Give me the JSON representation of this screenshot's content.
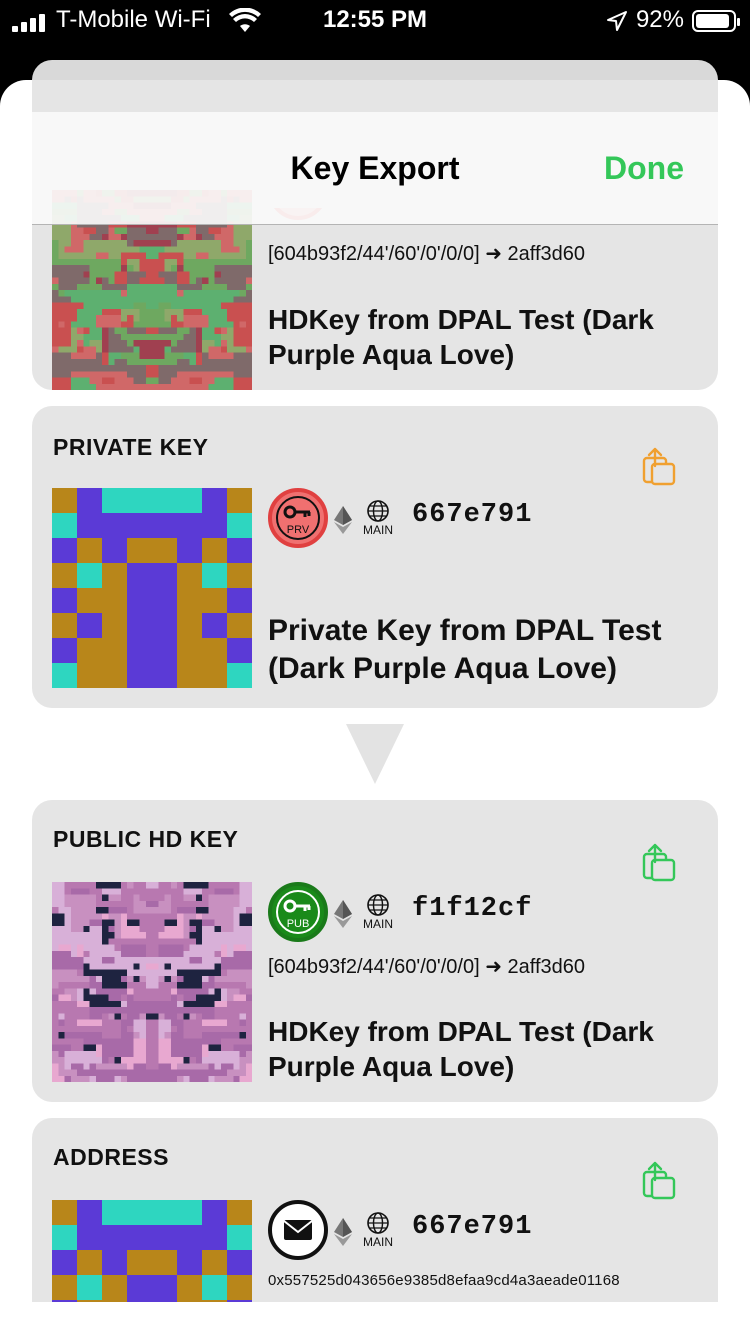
{
  "status_bar": {
    "carrier": "T-Mobile Wi-Fi",
    "time": "12:55 PM",
    "battery_percent": "92%",
    "battery_level": 0.92,
    "icons": [
      "signal-bars-icon",
      "wifi-icon",
      "location-arrow-icon",
      "battery-icon"
    ]
  },
  "navbar": {
    "title": "Key Export",
    "done_label": "Done",
    "accent_color": "#34c759"
  },
  "cards": {
    "hd_key_top": {
      "path": "[604b93f2/44'/60'/0'/0/0] ➜ 2aff3d60",
      "name": "HDKey from DPAL Test (Dark Purple Aqua Love)"
    },
    "private_key": {
      "label": "PRIVATE KEY",
      "badge": "PRV",
      "network": "MAIN",
      "key_id": "667e791",
      "name": "Private Key from DPAL Test (Dark Purple Aqua Love)",
      "share_color": "#f0a030"
    },
    "public_hd_key": {
      "label": "PUBLIC HD KEY",
      "badge": "PUB",
      "network": "MAIN",
      "key_id": "f1f12cf",
      "path": "[604b93f2/44'/60'/0'/0/0] ➜ 2aff3d60",
      "name": "HDKey from DPAL Test (Dark Purple Aqua Love)",
      "share_color": "#34c759"
    },
    "address": {
      "label": "ADDRESS",
      "network": "MAIN",
      "key_id": "667e791",
      "address": "0x557525d043656e9385d8efaa9cd4a3aeade01168",
      "share_color": "#34c759"
    }
  },
  "icons": [
    "ethereum-icon",
    "globe-icon",
    "share-icon",
    "down-arrow-icon",
    "envelope-icon",
    "key-icon"
  ]
}
